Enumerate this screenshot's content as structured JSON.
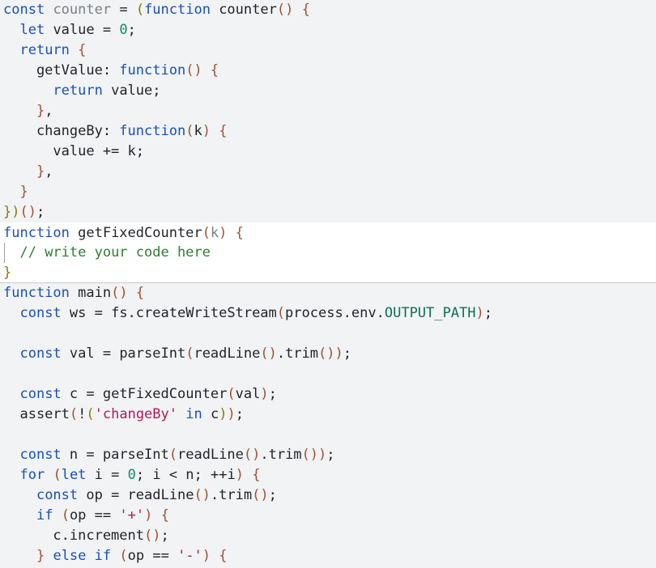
{
  "editor": {
    "lines": [
      "const counter = (function counter() {",
      "  let value = 0;",
      "  return {",
      "    getValue: function() {",
      "      return value;",
      "    },",
      "    changeBy: function(k) {",
      "      value += k;",
      "    },",
      "  }",
      "})();",
      "function getFixedCounter(k) {",
      "  // write your code here",
      "}",
      "function main() {",
      "  const ws = fs.createWriteStream(process.env.OUTPUT_PATH);",
      "",
      "  const val = parseInt(readLine().trim());",
      "",
      "  const c = getFixedCounter(val);",
      "  assert(!('changeBy' in c));",
      "",
      "  const n = parseInt(readLine().trim());",
      "  for (let i = 0; i < n; ++i) {",
      "    const op = readLine().trim();",
      "    if (op == '+') {",
      "      c.increment();",
      "    } else if (op == '-') {"
    ],
    "editable_region_lines": [
      12,
      13,
      14
    ],
    "colors": {
      "keyword": "#1a4fb8",
      "number": "#0f8a6a",
      "string": "#b1195a",
      "comment": "#2e7d32",
      "bracket": "#8a7a00",
      "background": "#f1f3f5",
      "editable_background": "#ffffff"
    }
  }
}
